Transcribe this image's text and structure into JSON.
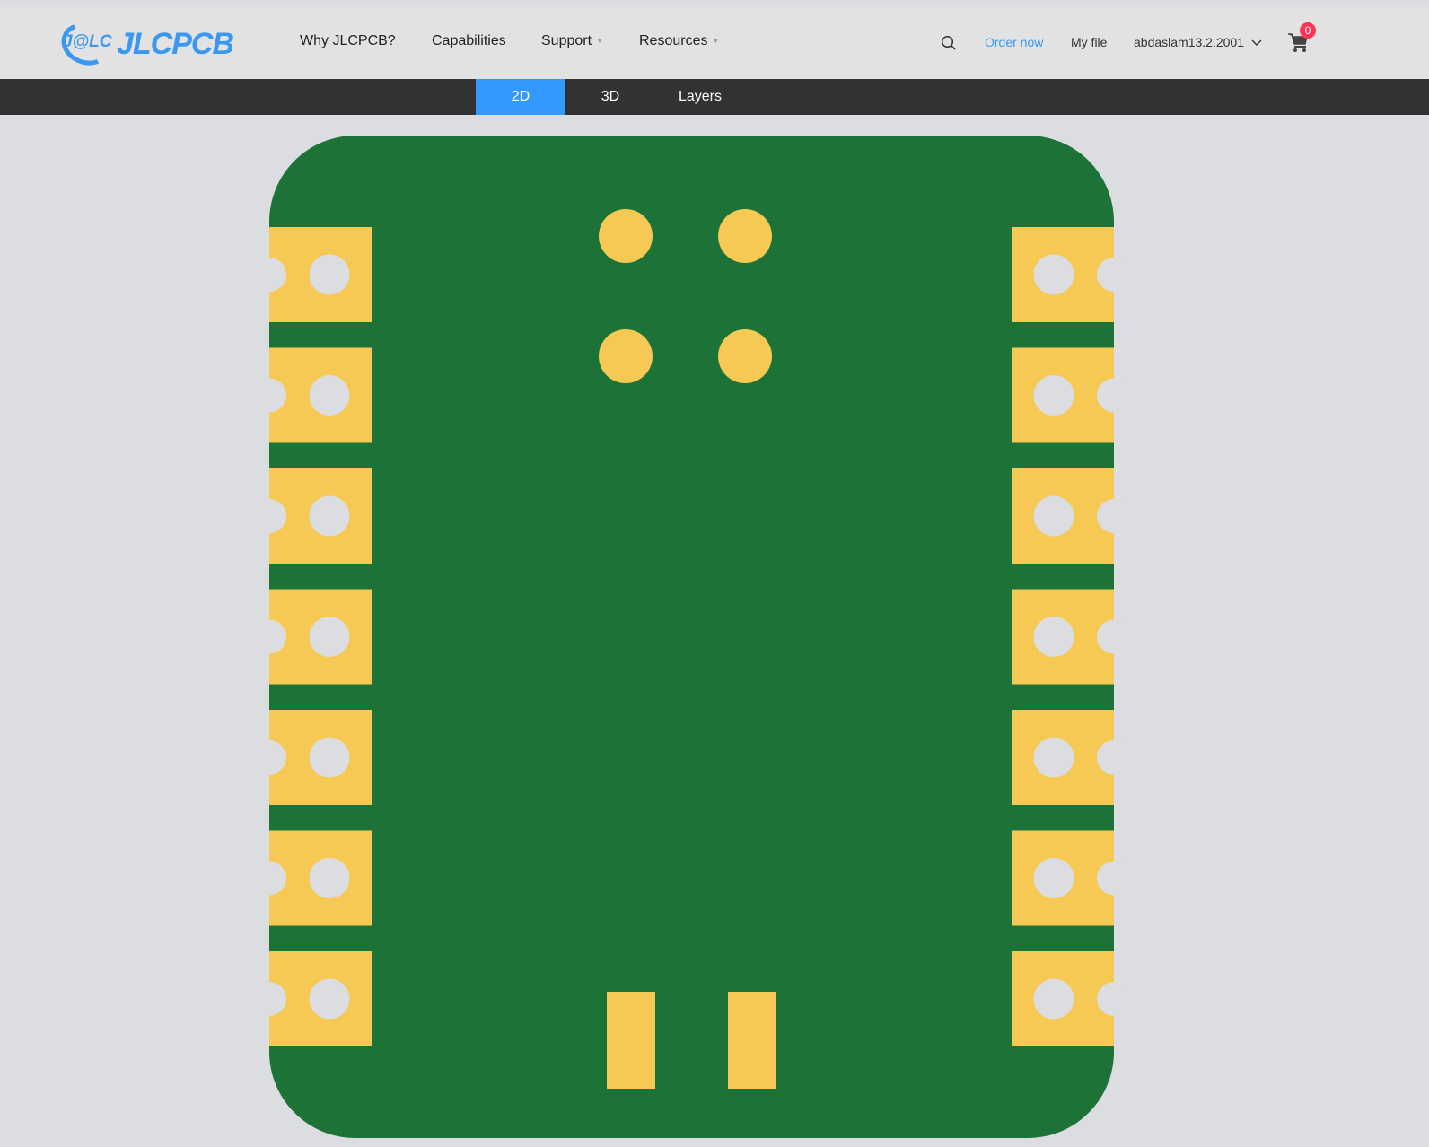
{
  "header": {
    "logo": {
      "mark": "J@LC",
      "text": "JLCPCB"
    },
    "nav": [
      {
        "label": "Why JLCPCB?"
      },
      {
        "label": "Capabilities"
      },
      {
        "label": "Support"
      },
      {
        "label": "Resources"
      }
    ],
    "order_now": "Order now",
    "my_file": "My file",
    "username": "abdaslam13.2.2001",
    "cart_count": "0"
  },
  "tabs": [
    {
      "label": "2D",
      "active": true
    },
    {
      "label": "3D"
    },
    {
      "label": "Layers"
    }
  ],
  "colors": {
    "accent": "#3399ff",
    "board": "#1d7337",
    "pad": "#f6c955",
    "background": "#dcdde0"
  }
}
